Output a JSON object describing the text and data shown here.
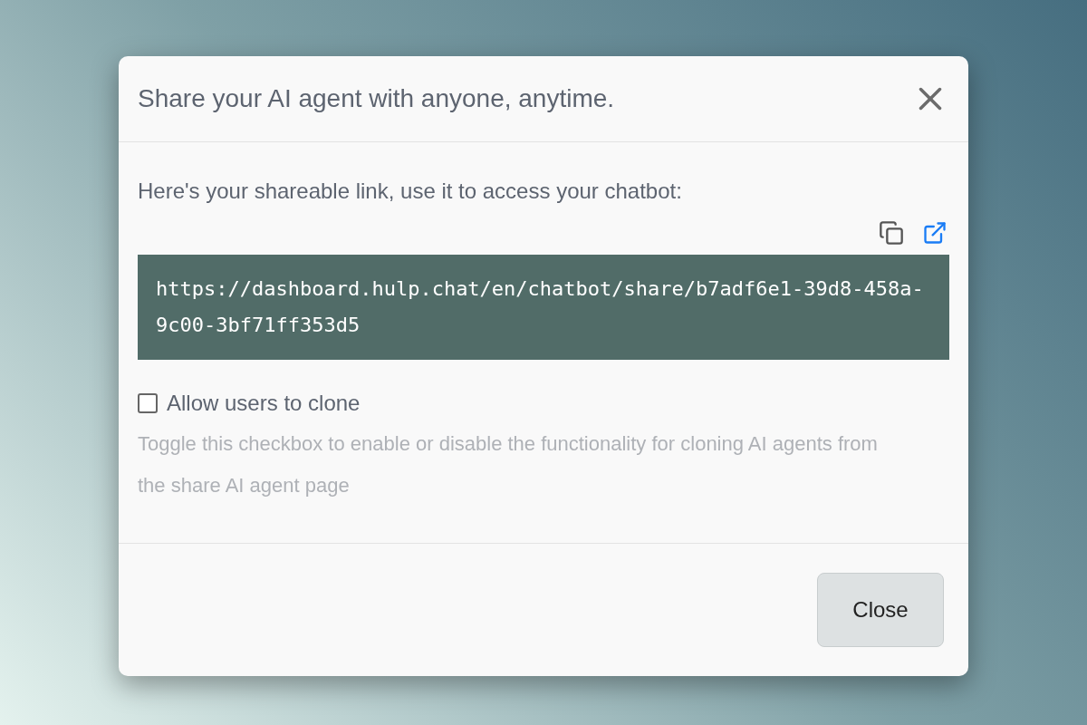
{
  "dialog": {
    "title": "Share your AI agent with anyone, anytime.",
    "intro": "Here's your shareable link, use it to access your chatbot:",
    "link": "https://dashboard.hulp.chat/en/chatbot/share/b7adf6e1-39d8-458a-9c00-3bf71ff353d5",
    "clone_option": {
      "label": "Allow users to clone",
      "checked": false
    },
    "help": "Toggle this checkbox to enable or disable the functionality for cloning AI agents from the share AI agent page",
    "buttons": [
      "Close"
    ]
  }
}
